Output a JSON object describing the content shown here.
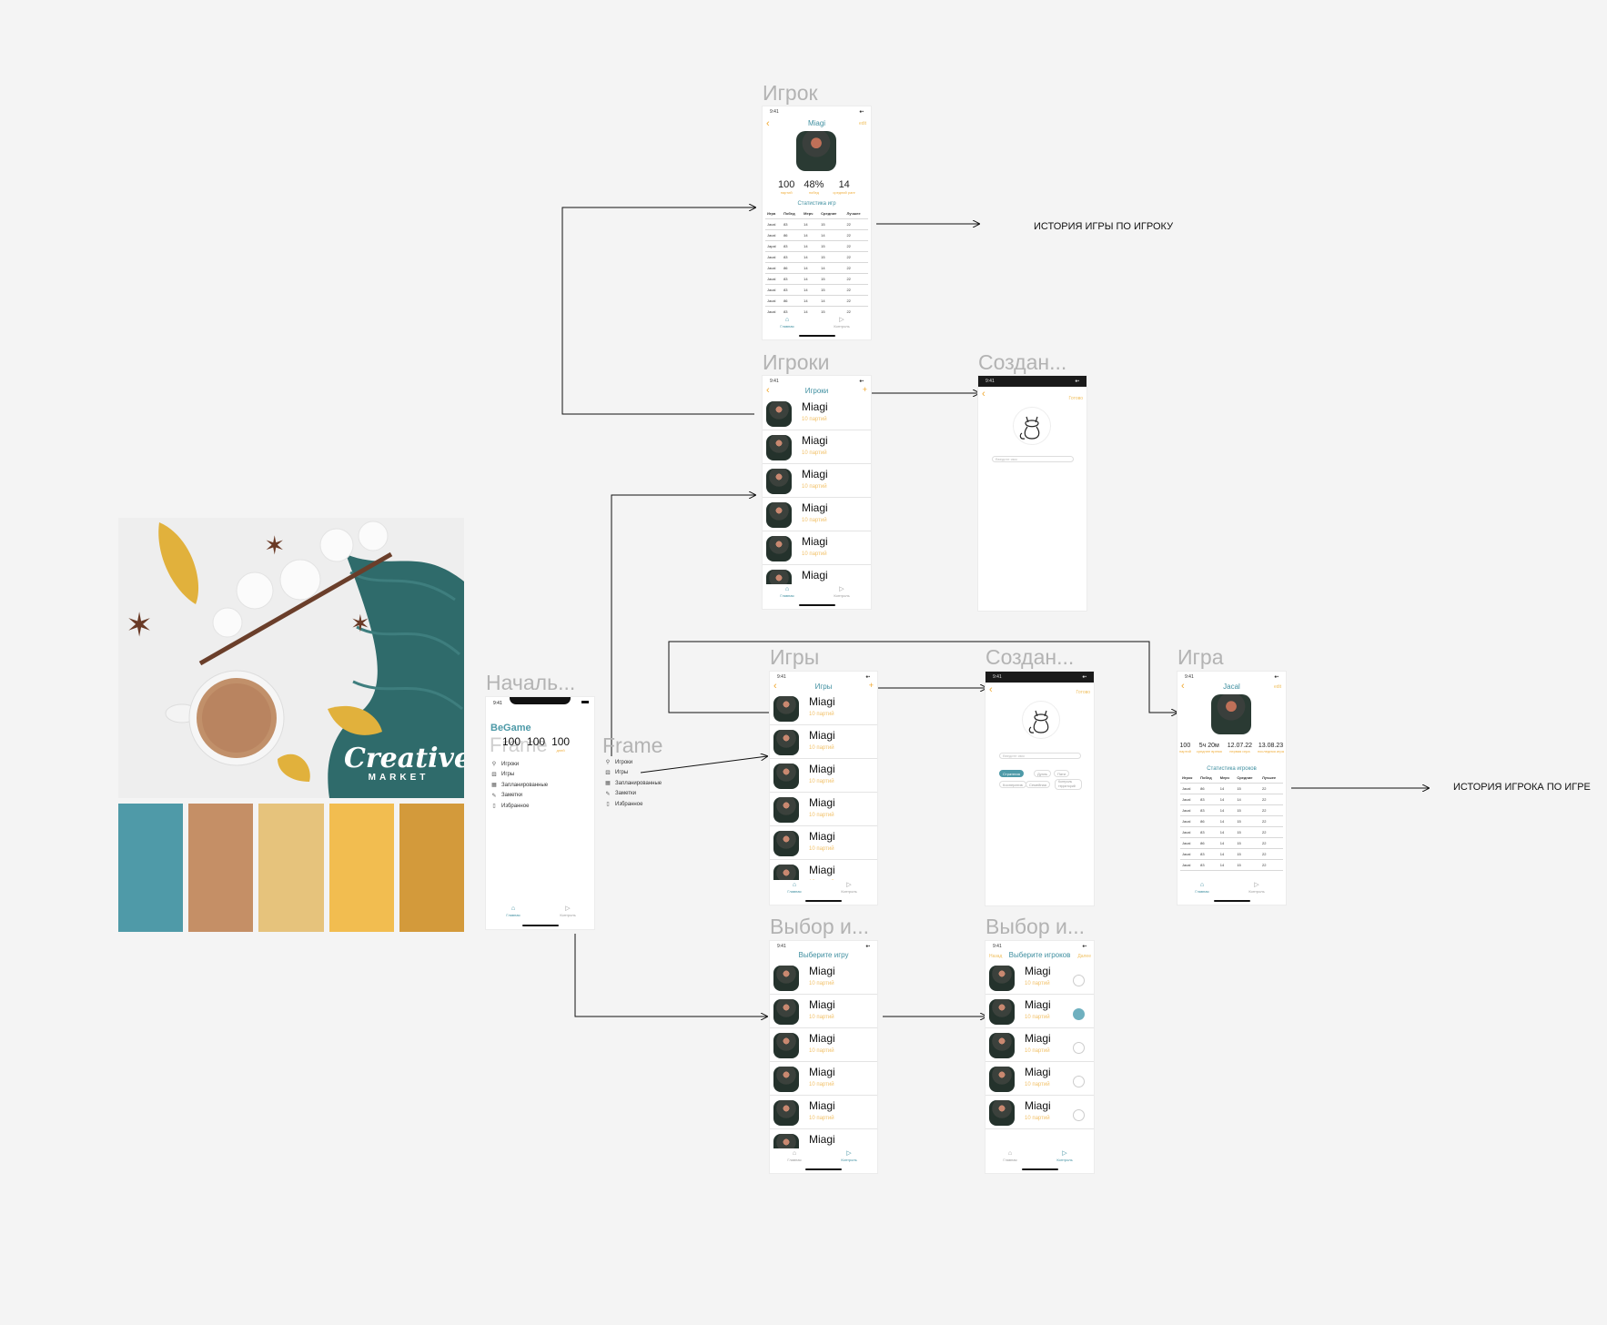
{
  "palette": {
    "brand_line1": "Creative",
    "brand_line2": "MARKET",
    "swatches": [
      "#4f9aa8",
      "#c58f66",
      "#e6c37c",
      "#f2bd50",
      "#d39a3b"
    ]
  },
  "frames": {
    "start": {
      "title": "Началь...",
      "overlay_title": "Frame",
      "app": "BeGame",
      "status_time": "9:41",
      "stats": [
        "100",
        "100",
        "100"
      ],
      "stat_caption": "дней",
      "menu": [
        "Игроки",
        "Игры",
        "Запланированные",
        "Заметки",
        "Избранное"
      ],
      "tabs": [
        "Главная",
        "Контроль"
      ]
    },
    "frame2": {
      "title": "Frame",
      "menu": [
        "Игроки",
        "Игры",
        "Запланированные",
        "Заметки",
        "Избранное"
      ]
    },
    "player": {
      "title": "Игрок",
      "nav": "Miagi",
      "right": "edit",
      "stats": [
        {
          "v": "100",
          "c": "партий"
        },
        {
          "v": "48%",
          "c": "побед"
        },
        {
          "v": "14",
          "c": "средний ранг"
        }
      ],
      "section": "Статистика игр",
      "headers": [
        "Игра",
        "Побед",
        "Мерч",
        "Средние",
        "Лучшее"
      ],
      "rows": [
        [
          "Jacal",
          "83",
          "14",
          "15",
          "22"
        ],
        [
          "Jacal",
          "86",
          "14",
          "14",
          "22"
        ],
        [
          "Japal",
          "83",
          "14",
          "15",
          "22"
        ],
        [
          "Jacal",
          "83",
          "14",
          "15",
          "22"
        ],
        [
          "Jacal",
          "86",
          "14",
          "14",
          "22"
        ],
        [
          "Jacal",
          "83",
          "14",
          "15",
          "22"
        ],
        [
          "Jacal",
          "83",
          "14",
          "15",
          "22"
        ],
        [
          "Jacal",
          "86",
          "14",
          "14",
          "22"
        ],
        [
          "Jacal",
          "83",
          "14",
          "15",
          "22"
        ]
      ],
      "tabs": [
        "Главная",
        "Контроль"
      ]
    },
    "players": {
      "title": "Игроки",
      "nav": "Игроки",
      "items": [
        {
          "name": "Miagi",
          "sub": "10 партий"
        },
        {
          "name": "Miagi",
          "sub": "10 партий"
        },
        {
          "name": "Miagi",
          "sub": "10 партий"
        },
        {
          "name": "Miagi",
          "sub": "10 партий"
        },
        {
          "name": "Miagi",
          "sub": "10 партий"
        },
        {
          "name": "Miagi",
          "sub": "10 партий"
        }
      ],
      "tabs": [
        "Главная",
        "Контроль"
      ]
    },
    "create_player": {
      "title": "Создан...",
      "right": "Готово",
      "placeholder": "Введите имя"
    },
    "games": {
      "title": "Игры",
      "nav": "Игры",
      "items": [
        {
          "name": "Miagi",
          "sub": "10 партий"
        },
        {
          "name": "Miagi",
          "sub": "10 партий"
        },
        {
          "name": "Miagi",
          "sub": "10 партий"
        },
        {
          "name": "Miagi",
          "sub": "10 партий"
        },
        {
          "name": "Miagi",
          "sub": "10 партий"
        },
        {
          "name": "Miagi",
          "sub": "10 партий"
        }
      ],
      "tabs": [
        "Главная",
        "Контроль"
      ]
    },
    "create_game": {
      "title": "Создан...",
      "right": "Готово",
      "placeholder": "Введите имя",
      "chips": [
        "Стратегия",
        "Дуэль",
        "Пати",
        "Кооператив",
        "Семейная",
        "Контроль территорий"
      ]
    },
    "game": {
      "title": "Игра",
      "nav": "Jacal",
      "right": "edit",
      "stats": [
        {
          "v": "100",
          "c": "партий"
        },
        {
          "v": "5ч 20м",
          "c": "среднее время"
        },
        {
          "v": "12.07.22",
          "c": "первая игра"
        },
        {
          "v": "13.08.23",
          "c": "последняя игра"
        }
      ],
      "section": "Статистика игроков",
      "headers": [
        "Игрок",
        "Побед",
        "Мерч",
        "Средние",
        "Лучшее"
      ],
      "rows": [
        [
          "Jacal",
          "86",
          "14",
          "15",
          "22"
        ],
        [
          "Jacal",
          "83",
          "14",
          "14",
          "22"
        ],
        [
          "Jacal",
          "83",
          "14",
          "15",
          "22"
        ],
        [
          "Jacal",
          "86",
          "14",
          "15",
          "22"
        ],
        [
          "Jacal",
          "83",
          "14",
          "15",
          "22"
        ],
        [
          "Jacal",
          "86",
          "14",
          "15",
          "22"
        ],
        [
          "Jacal",
          "83",
          "14",
          "15",
          "22"
        ],
        [
          "Jacal",
          "83",
          "14",
          "15",
          "22"
        ]
      ],
      "tabs": [
        "Главная",
        "Контроль"
      ]
    },
    "choose_game": {
      "title": "Выбор и...",
      "nav": "Выберите игру",
      "items": [
        {
          "name": "Miagi",
          "sub": "10 партий"
        },
        {
          "name": "Miagi",
          "sub": "10 партий"
        },
        {
          "name": "Miagi",
          "sub": "10 партий"
        },
        {
          "name": "Miagi",
          "sub": "10 партий"
        },
        {
          "name": "Miagi",
          "sub": "10 партий"
        },
        {
          "name": "Miagi",
          "sub": "10 партий"
        }
      ],
      "tabs": [
        "Главная",
        "Контроль"
      ]
    },
    "choose_players": {
      "title": "Выбор и...",
      "nav": "Выберите игроков",
      "left": "Назад",
      "right": "Далее",
      "items": [
        {
          "name": "Miagi",
          "sub": "10 партий",
          "checked": false
        },
        {
          "name": "Miagi",
          "sub": "10 партий",
          "checked": true
        },
        {
          "name": "Miagi",
          "sub": "10 партий",
          "checked": false
        },
        {
          "name": "Miagi",
          "sub": "10 партий",
          "checked": false
        },
        {
          "name": "Miagi",
          "sub": "10 партий",
          "checked": false
        }
      ],
      "tabs": [
        "Главная",
        "Контроль"
      ]
    }
  },
  "annotations": {
    "player_history": "ИСТОРИЯ ИГРЫ ПО ИГРОКУ",
    "game_history": "ИСТОРИЯ ИГРОКА ПО ИГРЕ"
  }
}
